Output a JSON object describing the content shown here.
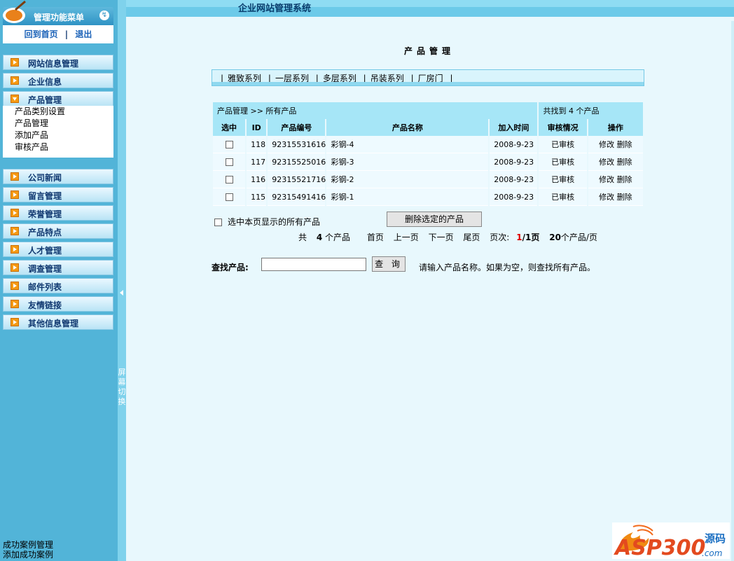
{
  "sidebar": {
    "title": "管理功能菜单",
    "home_link": "回到首页",
    "separator": "|",
    "logout_link": "退出",
    "groups": [
      {
        "label": "网站信息管理"
      },
      {
        "label": "企业信息"
      },
      {
        "label": "产品管理"
      },
      {
        "label": "公司新闻"
      },
      {
        "label": "留言管理"
      },
      {
        "label": "荣誉管理"
      },
      {
        "label": "产品特点"
      },
      {
        "label": "人才管理"
      },
      {
        "label": "调查管理"
      },
      {
        "label": "邮件列表"
      },
      {
        "label": "友情链接"
      },
      {
        "label": "其他信息管理"
      }
    ],
    "product_submenu": [
      "产品类别设置",
      "产品管理",
      "添加产品",
      "审核产品"
    ],
    "bottom_items": [
      "成功案例管理",
      "添加成功案例"
    ]
  },
  "splitter": {
    "label": "屏幕切换"
  },
  "header": {
    "system_title": "企业网站管理系统"
  },
  "main": {
    "page_title": "产品管理",
    "series": [
      "雅致系列",
      "一层系列",
      "多层系列",
      "吊装系列",
      "厂房门"
    ],
    "breadcrumb": "产品管理 >> 所有产品",
    "found_count": "共找到 4 个产品",
    "columns": [
      "选中",
      "ID",
      "产品编号",
      "产品名称",
      "加入时间",
      "审核情况",
      "操作"
    ],
    "rows": [
      {
        "id": "118",
        "code": "92315531616",
        "name": "彩钢-4",
        "date": "2008-9-23",
        "status": "已审核",
        "edit": "修改",
        "delete": "删除"
      },
      {
        "id": "117",
        "code": "92315525016",
        "name": "彩钢-3",
        "date": "2008-9-23",
        "status": "已审核",
        "edit": "修改",
        "delete": "删除"
      },
      {
        "id": "116",
        "code": "92315521716",
        "name": "彩钢-2",
        "date": "2008-9-23",
        "status": "已审核",
        "edit": "修改",
        "delete": "删除"
      },
      {
        "id": "115",
        "code": "92315491416",
        "name": "彩钢-1",
        "date": "2008-9-23",
        "status": "已审核",
        "edit": "修改",
        "delete": "删除"
      }
    ],
    "select_all_label": "选中本页显示的所有产品",
    "delete_button": "删除选定的产品",
    "pager": {
      "total_prefix": "共",
      "total": "4",
      "total_suffix": "个产品",
      "first": "首页",
      "prev": "上一页",
      "next": "下一页",
      "last": "尾页",
      "page_label": "页次:",
      "current": "1",
      "pages": "/1页",
      "per_page": "20",
      "per_page_suffix": "个产品/页"
    },
    "search": {
      "label": "查找产品:",
      "value": "",
      "button": "查 询",
      "hint": "请输入产品名称。如果为空，则查找所有产品。"
    }
  },
  "watermark": {
    "brand": "ASP300",
    "suffix": "源码",
    "domain": ".com"
  },
  "colors": {
    "sidebar_bg": "#52b4d8",
    "content_bg": "#e8f8fd",
    "table_header_bg": "#a6e6f7",
    "accent_orange": "#f59a13"
  }
}
